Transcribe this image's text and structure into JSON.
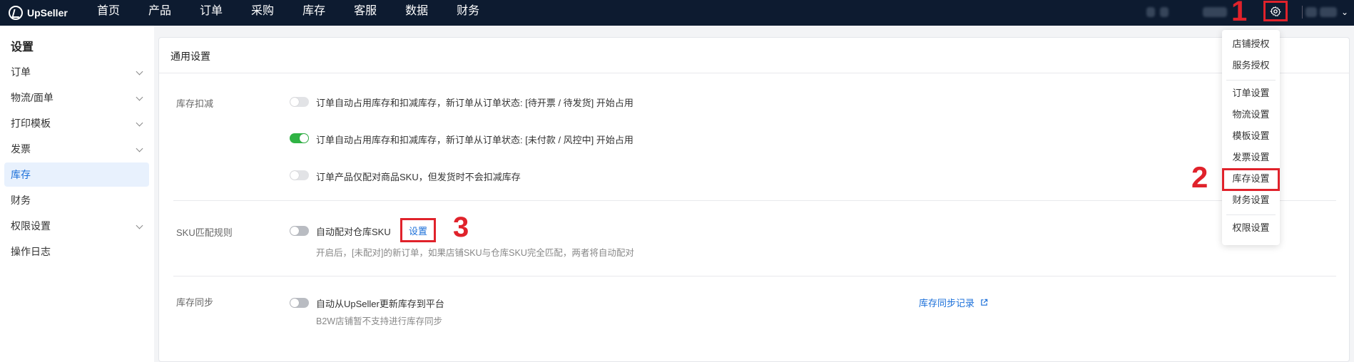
{
  "app": {
    "name": "UpSeller"
  },
  "nav": [
    "首页",
    "产品",
    "订单",
    "采购",
    "库存",
    "客服",
    "数据",
    "财务"
  ],
  "sidebar": {
    "title": "设置",
    "items": [
      {
        "label": "订单",
        "expandable": true
      },
      {
        "label": "物流/面单",
        "expandable": true
      },
      {
        "label": "打印模板",
        "expandable": true
      },
      {
        "label": "发票",
        "expandable": true
      },
      {
        "label": "库存",
        "expandable": false,
        "active": true
      },
      {
        "label": "财务",
        "expandable": false
      },
      {
        "label": "权限设置",
        "expandable": true
      },
      {
        "label": "操作日志",
        "expandable": false
      }
    ]
  },
  "main": {
    "title": "通用设置",
    "stock_deduction": {
      "label": "库存扣减",
      "options": [
        {
          "text": "订单自动占用库存和扣减库存，新订单从订单状态: [待开票 / 待发货] 开始占用",
          "on": false
        },
        {
          "text": "订单自动占用库存和扣减库存，新订单从订单状态: [未付款 / 风控中] 开始占用",
          "on": true
        },
        {
          "text": "订单产品仅配对商品SKU，但发货时不会扣减库存",
          "on": false
        }
      ]
    },
    "sku_match": {
      "label": "SKU匹配规则",
      "toggle_text": "自动配对仓库SKU",
      "settings_link": "设置",
      "description": "开启后，[未配对]的新订单，如果店铺SKU与仓库SKU完全匹配，两者将自动配对"
    },
    "stock_sync": {
      "label": "库存同步",
      "toggle_text": "自动从UpSeller更新库存到平台",
      "description": "B2W店铺暂不支持进行库存同步",
      "record_link": "库存同步记录"
    }
  },
  "dropdown": {
    "group1": [
      "店铺授权",
      "服务授权"
    ],
    "group2": [
      "订单设置",
      "物流设置",
      "模板设置",
      "发票设置",
      "库存设置",
      "财务设置"
    ],
    "group3": [
      "权限设置"
    ]
  },
  "annotations": [
    "1",
    "2",
    "3"
  ],
  "colors": {
    "topbar": "#0d1b30",
    "accent": "#1a6fd9",
    "annotation": "#e0222b",
    "toggle_on": "#2fb344"
  },
  "icons": [
    "logo-icon",
    "gear-icon",
    "chevron-down-icon",
    "external-link-icon"
  ]
}
